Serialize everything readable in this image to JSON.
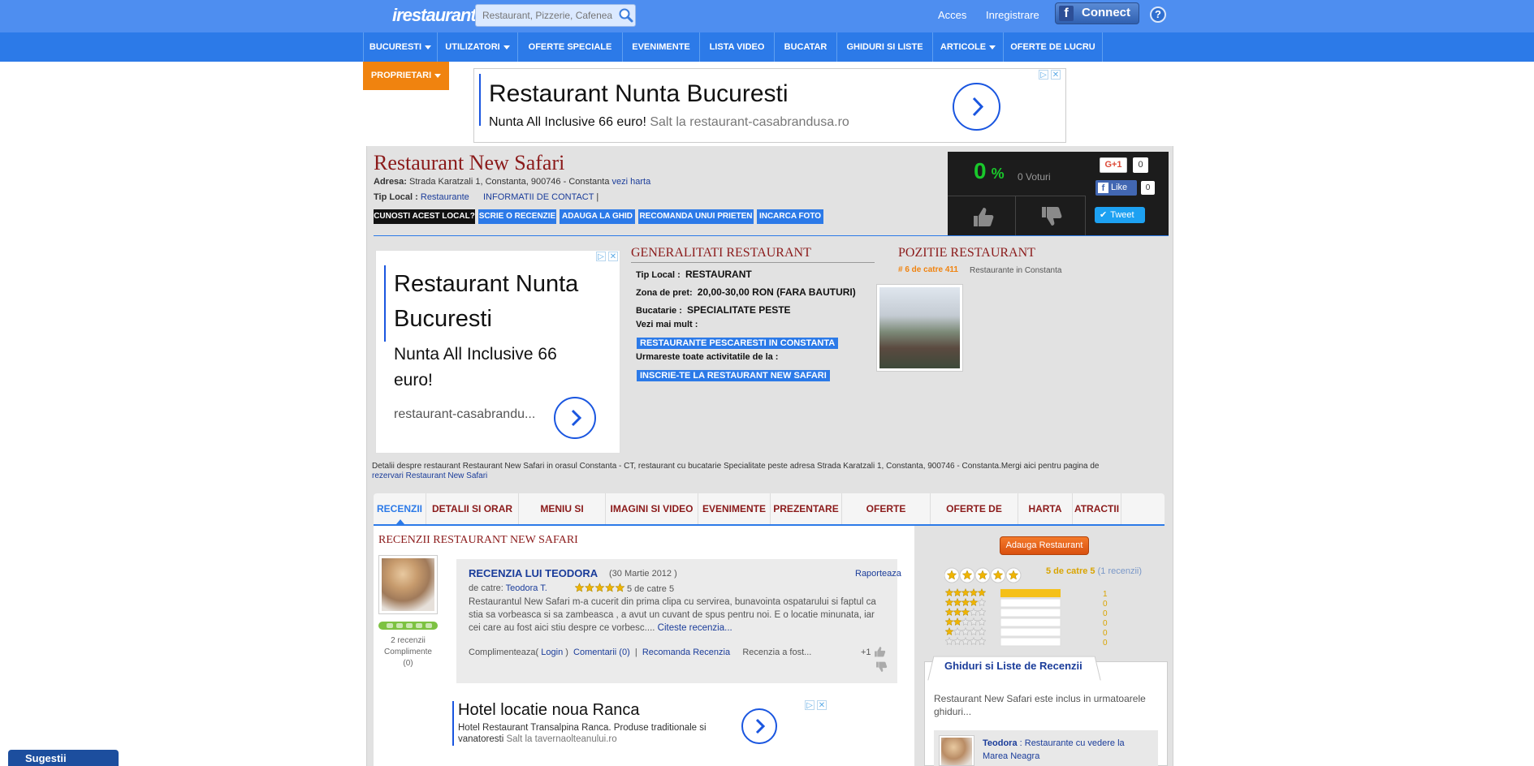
{
  "header": {
    "logo_text": "irestaurant",
    "search_placeholder": "Restaurant, Pizzerie, Cafenea...",
    "acces": "Acces",
    "inregistrare": "Inregistrare",
    "fb_connect": "Connect",
    "help": "?"
  },
  "nav": {
    "items": [
      "BUCURESTI",
      "UTILIZATORI",
      "OFERTE SPECIALE",
      "EVENIMENTE",
      "LISTA VIDEO",
      "BUCATAR",
      "GHIDURI SI LISTE",
      "ARTICOLE",
      "OFERTE DE LUCRU"
    ],
    "proprietari": "PROPRIETARI"
  },
  "top_ad": {
    "title": "Restaurant Nunta Bucuresti",
    "text": "Nunta All Inclusive 66 euro!",
    "link": "Salt la restaurant-casabrandusa.ro"
  },
  "restaurant": {
    "name": "Restaurant New Safari",
    "address_label": "Adresa:",
    "address": "Strada Karatzali 1, Constanta, 900746 - Constanta",
    "map_link": "vezi harta",
    "type_label": "Tip Local :",
    "type_link": "Restaurante",
    "contact_link": "INFORMATII DE CONTACT",
    "buttons": [
      "CUNOSTI ACEST LOCAL?",
      "SCRIE O RECENZIE",
      "ADAUGA LA GHID",
      "RECOMANDA UNUI PRIETEN",
      "INCARCA FOTO"
    ]
  },
  "vote": {
    "percent": "0",
    "percent_sign": "%",
    "votes": "0 Voturi",
    "gplus": "+1",
    "gplus_count": "0",
    "fb_like": "Like",
    "fb_count": "0",
    "tweet": "Tweet"
  },
  "side_ad": {
    "title": "Restaurant Nunta Bucuresti",
    "text": "Nunta All Inclusive 66 euro!",
    "link": "restaurant-casabrandu..."
  },
  "generalitati": {
    "heading": "GENERALITATI RESTAURANT",
    "tip_label": "Tip Local :",
    "tip_value": "RESTAURANT",
    "pret_label": "Zona de pret:",
    "pret_value": "20,00-30,00 RON (FARA BAUTURI)",
    "bucatarie_label": "Bucatarie :",
    "bucatarie_value": "SPECIALITATE PESTE",
    "vezi_label": "Vezi mai mult :",
    "vezi_link": "RESTAURANTE PESCARESTI IN CONSTANTA",
    "urmareste_label": "Urmareste toate activitatile de la :",
    "urmareste_link": "INSCRIE-TE LA RESTAURANT NEW SAFARI"
  },
  "pozitie": {
    "heading": "POZITIE RESTAURANT",
    "rank": "# 6 de catre 411",
    "link": "Restaurante in Constanta"
  },
  "description": {
    "text": "Detalii despre restaurant Restaurant New Safari in orasul Constanta - CT, restaurant cu bucatarie Specialitate peste adresa Strada Karatzali 1, Constanta, 900746 - Constanta.Mergi aici pentru pagina de",
    "link": "rezervari Restaurant New Safari"
  },
  "tabs": [
    "RECENZII",
    "DETALII SI ORAR",
    "MENIU SI PRETURI",
    "IMAGINI SI VIDEO",
    "EVENIMENTE",
    "PREZENTARE",
    "OFERTE SPECIALE",
    "OFERTE DE LUCRU",
    "HARTA",
    "ATRACTII"
  ],
  "reviews": {
    "heading": "RECENZII RESTAURANT NEW SAFARI",
    "user_stats": "2 recenzii",
    "user_compl": "Complimente",
    "user_compl_count": "(0)",
    "title": "RECENZIA LUI TEODORA",
    "date": "(30 Martie 2012 )",
    "report": "Raporteaza",
    "by_label": "de catre:",
    "by_user": "Teodora T.",
    "rating_text": "5 de catre 5",
    "rating": 5,
    "body": "Restaurantul New Safari m-a cucerit din prima clipa cu servirea, bunavointa ospatarului si faptul ca stia sa vorbeasca si sa zambeasca , a avut un cuvant de spus pentru noi. E o locatie minunata, iar cei care au fost aici stiu despre ce vorbesc....",
    "read_more": "Citeste recenzia...",
    "compl_label": "Complimenteaza(",
    "login": "Login",
    "compl_close": ")",
    "comments": "Comentarii (0)",
    "recommend": "Recomanda Recenzia",
    "recenzia_a": "Recenzia a fost...",
    "plus_one": "+1"
  },
  "bottom_ad": {
    "title": "Hotel locatie noua Ranca",
    "text": "Hotel Restaurant Transalpina Ranca. Produse traditionale si vanatoresti",
    "link": "Salt la tavernaolteanului.ro"
  },
  "sidebar": {
    "add_button": "Adauga Restaurant",
    "summary": "5 de catre 5",
    "summary_count": "(1 recenzii)",
    "overall_rating": 5,
    "distribution": [
      {
        "stars": 5,
        "count": "1",
        "share": 1.0
      },
      {
        "stars": 4,
        "count": "0",
        "share": 0
      },
      {
        "stars": 3,
        "count": "0",
        "share": 0
      },
      {
        "stars": 2,
        "count": "0",
        "share": 0
      },
      {
        "stars": 1,
        "count": "0",
        "share": 0
      },
      {
        "stars": 0,
        "count": "0",
        "share": 0
      }
    ],
    "guides_tab": "Ghiduri si Liste de Recenzii",
    "guides_text": "Restaurant New Safari este inclus in urmatoarele ghiduri...",
    "guide_user": "Teodora",
    "guide_sep": " : ",
    "guide_link": "Restaurante cu vedere la Marea Neagra"
  },
  "sugestii": "Sugestii",
  "colors": {
    "brand_blue": "#2c7ae8",
    "maroon": "#8b1a1a",
    "orange": "#f0830f",
    "vote_green": "#19c82b"
  }
}
